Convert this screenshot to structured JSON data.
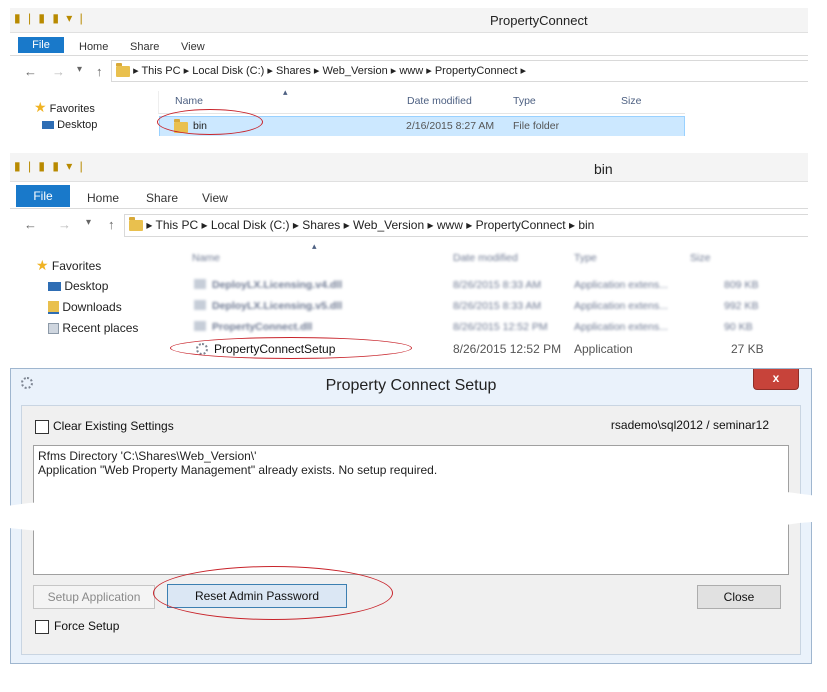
{
  "window1": {
    "title": "PropertyConnect",
    "quick_access": "▮ | ▮ ▮ ▾ |",
    "ribbon_tabs": [
      "File",
      "Home",
      "Share",
      "View"
    ],
    "nav": {
      "back": "←",
      "forward": "→",
      "dropdown": "▾",
      "up": "↑"
    },
    "breadcrumb": [
      "This PC",
      "Local Disk (C:)",
      "Shares",
      "Web_Version",
      "www",
      "PropertyConnect"
    ],
    "sort_arrow": "▴",
    "columns": [
      "Name",
      "Date modified",
      "Type",
      "Size"
    ],
    "nav_pane": [
      "Favorites",
      "Desktop"
    ],
    "rows": [
      {
        "name": "bin",
        "date": "2/16/2015 8:27 AM",
        "type": "File folder",
        "size": ""
      }
    ]
  },
  "window2": {
    "title": "bin",
    "quick_access": "▮ | ▮ ▮ ▾ |",
    "ribbon_tabs": [
      "File",
      "Home",
      "Share",
      "View"
    ],
    "nav": {
      "back": "←",
      "forward": "→",
      "dropdown": "▾",
      "up": "↑"
    },
    "breadcrumb": [
      "This PC",
      "Local Disk (C:)",
      "Shares",
      "Web_Version",
      "www",
      "PropertyConnect",
      "bin"
    ],
    "sort_arrow": "▴",
    "columns": [
      "Name",
      "Date modified",
      "Type",
      "Size"
    ],
    "nav_pane": [
      "Favorites",
      "Desktop",
      "Downloads",
      "Recent places"
    ],
    "rows": [
      {
        "name": "DeployLX.Licensing.v4.dll",
        "date": "8/26/2015 8:33 AM",
        "type": "Application extens...",
        "size": "809 KB"
      },
      {
        "name": "DeployLX.Licensing.v5.dll",
        "date": "8/26/2015 8:33 AM",
        "type": "Application extens...",
        "size": "992 KB"
      },
      {
        "name": "PropertyConnect.dll",
        "date": "8/26/2015 12:52 PM",
        "type": "Application extens...",
        "size": "90 KB"
      },
      {
        "name": "PropertyConnectSetup",
        "date": "8/26/2015 12:52 PM",
        "type": "Application",
        "size": "27 KB"
      }
    ]
  },
  "setup_dialog": {
    "title": "Property Connect Setup",
    "close": "x",
    "clear_settings_label": "Clear Existing Settings",
    "server_info": "rsademo\\sql2012 / seminar12",
    "log_lines": [
      "Rfms Directory 'C:\\Shares\\Web_Version\\'",
      "Application \"Web Property Management\" already exists. No setup required."
    ],
    "setup_application": "Setup Application",
    "reset_admin_password": "Reset Admin Password",
    "close_button": "Close",
    "force_setup_label": "Force Setup"
  }
}
